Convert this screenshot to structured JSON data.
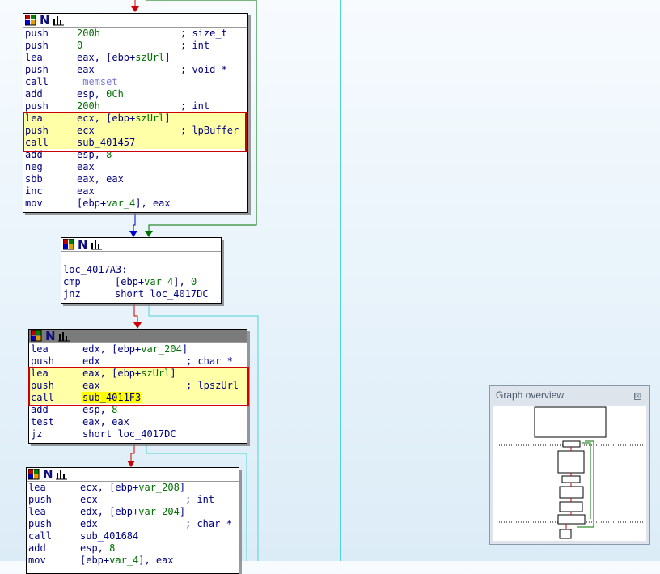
{
  "nodes": [
    {
      "id": "block1",
      "lines": [
        {
          "mn": "push",
          "op": [
            {
              "t": "200h",
              "c": "num"
            }
          ],
          "cmt": "; size_t"
        },
        {
          "mn": "push",
          "op": [
            {
              "t": "0",
              "c": "num"
            }
          ],
          "cmt": "; int"
        },
        {
          "mn": "lea",
          "op": [
            {
              "t": "eax, [ebp+",
              "c": "op"
            },
            {
              "t": "szUrl",
              "c": "var"
            },
            {
              "t": "]",
              "c": "op"
            }
          ],
          "cmt": ""
        },
        {
          "mn": "push",
          "op": [
            {
              "t": "eax",
              "c": "op"
            }
          ],
          "cmt": "; void *"
        },
        {
          "mn": "call",
          "op": [
            {
              "t": "_memset",
              "c": "ext"
            }
          ],
          "cmt": ""
        },
        {
          "mn": "add",
          "op": [
            {
              "t": "esp, ",
              "c": "op"
            },
            {
              "t": "0Ch",
              "c": "num"
            }
          ],
          "cmt": ""
        },
        {
          "mn": "push",
          "op": [
            {
              "t": "200h",
              "c": "num"
            }
          ],
          "cmt": "; int"
        },
        {
          "mn": "lea",
          "op": [
            {
              "t": "ecx, [ebp+",
              "c": "op"
            },
            {
              "t": "szUrl",
              "c": "var"
            },
            {
              "t": "]",
              "c": "op"
            }
          ],
          "cmt": "",
          "hl": true
        },
        {
          "mn": "push",
          "op": [
            {
              "t": "ecx",
              "c": "op"
            }
          ],
          "cmt": "; lpBuffer",
          "hl": true
        },
        {
          "mn": "call",
          "op": [
            {
              "t": "sub_401457",
              "c": "op"
            }
          ],
          "cmt": "",
          "hl": true
        },
        {
          "mn": "add",
          "op": [
            {
              "t": "esp, ",
              "c": "op"
            },
            {
              "t": "8",
              "c": "num"
            }
          ],
          "cmt": ""
        },
        {
          "mn": "neg",
          "op": [
            {
              "t": "eax",
              "c": "op"
            }
          ],
          "cmt": ""
        },
        {
          "mn": "sbb",
          "op": [
            {
              "t": "eax, eax",
              "c": "op"
            }
          ],
          "cmt": ""
        },
        {
          "mn": "inc",
          "op": [
            {
              "t": "eax",
              "c": "op"
            }
          ],
          "cmt": ""
        },
        {
          "mn": "mov",
          "op": [
            {
              "t": "[ebp+",
              "c": "op"
            },
            {
              "t": "var_4",
              "c": "var"
            },
            {
              "t": "], eax",
              "c": "op"
            }
          ],
          "cmt": ""
        }
      ]
    },
    {
      "id": "block2",
      "lines": [
        {
          "mn": "",
          "op": [],
          "cmt": ""
        },
        {
          "mn": "loc_4017A3:",
          "op": [],
          "cmt": "",
          "label": true
        },
        {
          "mn": "cmp",
          "op": [
            {
              "t": "[ebp+",
              "c": "op"
            },
            {
              "t": "var_4",
              "c": "var"
            },
            {
              "t": "], ",
              "c": "op"
            },
            {
              "t": "0",
              "c": "num"
            }
          ],
          "cmt": ""
        },
        {
          "mn": "jnz",
          "op": [
            {
              "t": "short loc_4017DC",
              "c": "op"
            }
          ],
          "cmt": ""
        }
      ]
    },
    {
      "id": "block3",
      "lines": [
        {
          "mn": "lea",
          "op": [
            {
              "t": "edx, [ebp+",
              "c": "op"
            },
            {
              "t": "var_204",
              "c": "var"
            },
            {
              "t": "]",
              "c": "op"
            }
          ],
          "cmt": ""
        },
        {
          "mn": "push",
          "op": [
            {
              "t": "edx",
              "c": "op"
            }
          ],
          "cmt": "; char *"
        },
        {
          "mn": "lea",
          "op": [
            {
              "t": "eax, [ebp+",
              "c": "op"
            },
            {
              "t": "szUrl",
              "c": "var"
            },
            {
              "t": "]",
              "c": "op"
            }
          ],
          "cmt": "",
          "hl": true
        },
        {
          "mn": "push",
          "op": [
            {
              "t": "eax",
              "c": "op"
            }
          ],
          "cmt": "; lpszUrl",
          "hl": true
        },
        {
          "mn": "call",
          "op": [
            {
              "t": "sub_4011F3",
              "c": "subhl"
            }
          ],
          "cmt": "",
          "hl": true
        },
        {
          "mn": "add",
          "op": [
            {
              "t": "esp, ",
              "c": "op"
            },
            {
              "t": "8",
              "c": "num"
            }
          ],
          "cmt": ""
        },
        {
          "mn": "test",
          "op": [
            {
              "t": "eax, eax",
              "c": "op"
            }
          ],
          "cmt": ""
        },
        {
          "mn": "jz",
          "op": [
            {
              "t": "short loc_4017DC",
              "c": "op"
            }
          ],
          "cmt": ""
        }
      ]
    },
    {
      "id": "block4",
      "lines": [
        {
          "mn": "lea",
          "op": [
            {
              "t": "ecx, [ebp+",
              "c": "op"
            },
            {
              "t": "var_208",
              "c": "var"
            },
            {
              "t": "]",
              "c": "op"
            }
          ],
          "cmt": ""
        },
        {
          "mn": "push",
          "op": [
            {
              "t": "ecx",
              "c": "op"
            }
          ],
          "cmt": "; int"
        },
        {
          "mn": "lea",
          "op": [
            {
              "t": "edx, [ebp+",
              "c": "op"
            },
            {
              "t": "var_204",
              "c": "var"
            },
            {
              "t": "]",
              "c": "op"
            }
          ],
          "cmt": ""
        },
        {
          "mn": "push",
          "op": [
            {
              "t": "edx",
              "c": "op"
            }
          ],
          "cmt": "; char *"
        },
        {
          "mn": "call",
          "op": [
            {
              "t": "sub_401684",
              "c": "op"
            }
          ],
          "cmt": ""
        },
        {
          "mn": "add",
          "op": [
            {
              "t": "esp, ",
              "c": "op"
            },
            {
              "t": "8",
              "c": "num"
            }
          ],
          "cmt": ""
        },
        {
          "mn": "mov",
          "op": [
            {
              "t": "[ebp+",
              "c": "op"
            },
            {
              "t": "var_4",
              "c": "var"
            },
            {
              "t": "], eax",
              "c": "op"
            }
          ],
          "cmt": ""
        }
      ]
    }
  ],
  "overview": {
    "title": "Graph overview",
    "close_glyph": "☒"
  },
  "colors": {
    "edge_true": "#007000",
    "edge_false": "#cc0000",
    "edge_uncond": "#0000cc",
    "edge_back": "#4fd4d4",
    "highlight_box": "#cc0000",
    "highlight_fill": "#ffffa8"
  }
}
